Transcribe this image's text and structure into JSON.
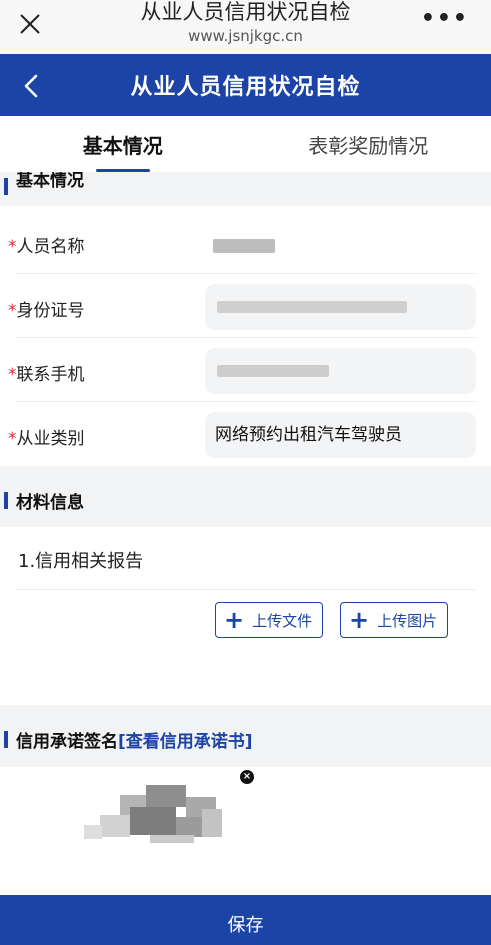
{
  "browser": {
    "title": "从业人员信用状况自检",
    "url": "www.jsnjkgc.cn",
    "close_icon": "close-icon",
    "more_label": "•••"
  },
  "header": {
    "title": "从业人员信用状况自检",
    "back_icon": "chevron-left-icon"
  },
  "tabs": [
    {
      "label": "基本情况",
      "active": true
    },
    {
      "label": "表彰奖励情况",
      "active": false
    }
  ],
  "basic_section": {
    "title": "基本情况",
    "required_mark": "*",
    "fields": [
      {
        "label": "人员名称",
        "value": ""
      },
      {
        "label": "身份证号",
        "value": ""
      },
      {
        "label": "联系手机",
        "value": ""
      },
      {
        "label": "从业类别",
        "value": "网络预约出租汽车驾驶员"
      }
    ]
  },
  "materials_section": {
    "title": "材料信息",
    "item_title": "1.信用相关报告",
    "upload_file_label": "上传文件",
    "upload_image_label": "上传图片",
    "plus_glyph": "+"
  },
  "commitment_section": {
    "title": "信用承诺签名",
    "link_text": "[查看信用承诺书]",
    "remove_glyph": "×"
  },
  "footer": {
    "save_label": "保存"
  },
  "colors": {
    "brand_blue": "#1b44a6",
    "required_red": "#d9303a",
    "page_bg": "#f2f3f5"
  }
}
